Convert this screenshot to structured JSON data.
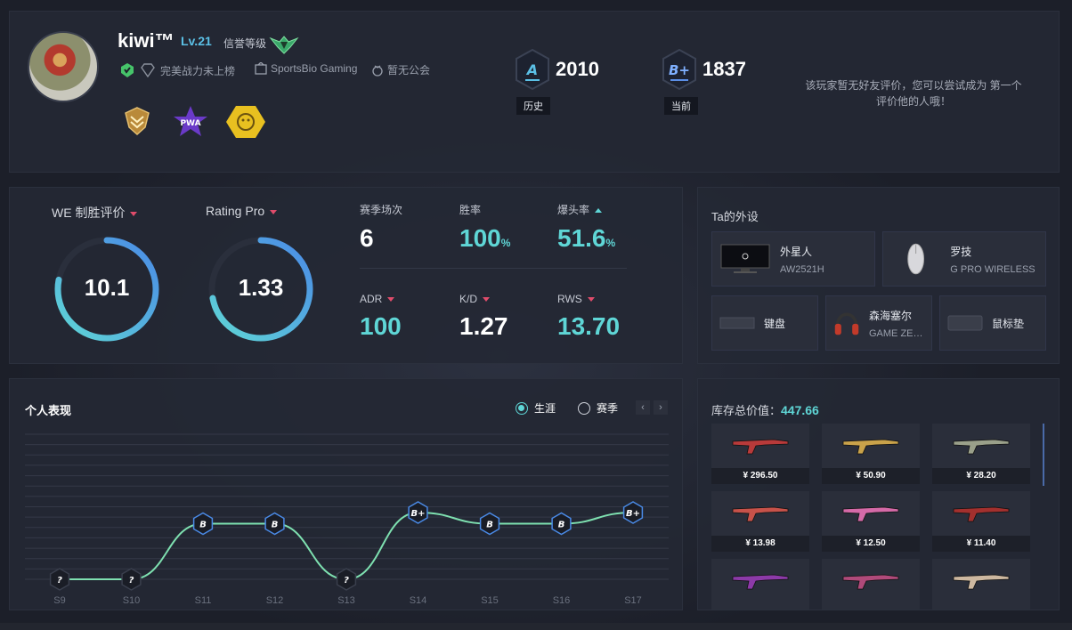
{
  "profile": {
    "username": "kiwi™",
    "level": "Lv.21",
    "credit_label": "信誉等级",
    "power_rank": "完美战力未上榜",
    "team": "SportsBio Gaming",
    "guild": "暂无公会"
  },
  "rank_history": {
    "grade": "A",
    "score": "2010",
    "label": "历史"
  },
  "rank_current": {
    "grade": "B+",
    "score": "1837",
    "label": "当前"
  },
  "friend_eval": "该玩家暂无好友评价，您可以尝试成为 第一个评价他的人哦！",
  "stats": {
    "we_label": "WE 制胜评价",
    "we_value": "10.1",
    "we_fraction": 0.78,
    "rating_label": "Rating Pro",
    "rating_value": "1.33",
    "rating_fraction": 0.72,
    "season_matches_label": "赛季场次",
    "season_matches": "6",
    "winrate_label": "胜率",
    "winrate": "100",
    "headshot_label": "爆头率",
    "headshot": "51.6",
    "percent": "%",
    "adr_label": "ADR",
    "adr": "100",
    "kd_label": "K/D",
    "kd": "1.27",
    "rws_label": "RWS",
    "rws": "13.70"
  },
  "gear": {
    "title": "Ta的外设",
    "items": [
      {
        "name": "外星人",
        "model": "AW2521H",
        "icon": "monitor-icon"
      },
      {
        "name": "罗技",
        "model": "G PRO WIRELESS",
        "icon": "mouse-icon"
      },
      {
        "name": "键盘",
        "model": "",
        "icon": "keyboard-icon"
      },
      {
        "name": "森海塞尔",
        "model": "GAME ZERO",
        "icon": "headset-icon"
      },
      {
        "name": "鼠标垫",
        "model": "",
        "icon": "mousepad-icon"
      }
    ]
  },
  "performance": {
    "title": "个人表现",
    "legend_career": "生涯",
    "legend_season": "赛季",
    "prev": "‹",
    "next": "›"
  },
  "chart_data": {
    "type": "line",
    "categories": [
      "S9",
      "S10",
      "S11",
      "S12",
      "S13",
      "S14",
      "S15",
      "S16",
      "S17"
    ],
    "values": [
      0,
      0,
      5,
      5,
      0,
      6,
      5,
      5,
      6
    ],
    "point_labels": [
      "?",
      "?",
      "B",
      "B",
      "?",
      "B+",
      "B",
      "B",
      "B+"
    ],
    "grid": true,
    "line_color": "#7ee0b0"
  },
  "inventory": {
    "total_label": "库存总价值：",
    "total_value": "447.66",
    "items": [
      {
        "price": "¥ 296.50",
        "color": "#b83a3a"
      },
      {
        "price": "¥ 50.90",
        "color": "#c9a24a"
      },
      {
        "price": "¥ 28.20",
        "color": "#9aa08a"
      },
      {
        "price": "¥ 13.98",
        "color": "#c7524a"
      },
      {
        "price": "¥ 12.50",
        "color": "#d56aa8"
      },
      {
        "price": "¥ 11.40",
        "color": "#a3302e"
      },
      {
        "price": "",
        "color": "#8c3aa8"
      },
      {
        "price": "",
        "color": "#b04a7a"
      },
      {
        "price": "",
        "color": "#cdb8a0"
      }
    ]
  }
}
